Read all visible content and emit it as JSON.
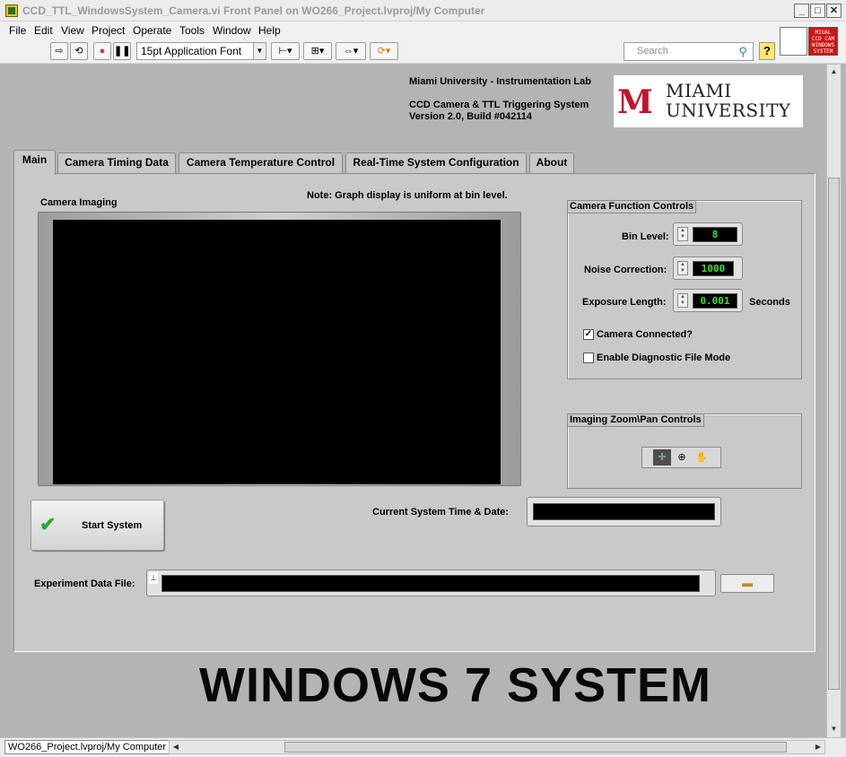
{
  "window": {
    "title": "CCD_TTL_WindowsSystem_Camera.vi Front Panel on WO266_Project.lvproj/My Computer",
    "minimize": "_",
    "maximize": "□",
    "close": "✕"
  },
  "menu": [
    "File",
    "Edit",
    "View",
    "Project",
    "Operate",
    "Tools",
    "Window",
    "Help"
  ],
  "toolbar": {
    "font": "15pt Application Font",
    "search_placeholder": "Search",
    "help": "?"
  },
  "vi_icon_text": [
    "MIUAL",
    "CCD CAM",
    "WINDOWS",
    "SYSTEM"
  ],
  "header": {
    "lab": "Miami University - Instrumentation Lab",
    "system": "CCD Camera & TTL Triggering System",
    "version": "Version 2.0, Build #042114",
    "logo_mark": "M",
    "logo_line1": "MIAMI",
    "logo_line2": "UNIVERSITY"
  },
  "tabs": [
    "Main",
    "Camera Timing Data",
    "Camera Temperature Control",
    "Real-Time System Configuration",
    "About"
  ],
  "active_tab": "Main",
  "main": {
    "graph_label": "Camera Imaging",
    "note": "Note: Graph display is uniform at bin level.",
    "camera_controls_title": "Camera Function Controls",
    "bin_label": "Bin Level:",
    "bin_value": "8",
    "noise_label": "Noise Correction:",
    "noise_value": "1000",
    "exposure_label": "Exposure Length:",
    "exposure_value": "0.001",
    "exposure_unit": "Seconds",
    "camera_connected_label": "Camera Connected?",
    "camera_connected": true,
    "diagnostic_label": "Enable Diagnostic File Mode",
    "diagnostic": false,
    "zoom_title": "Imaging Zoom\\Pan Controls",
    "start_label": "Start System",
    "time_label": "Current System Time & Date:",
    "time_value": "",
    "data_file_label": "Experiment Data File:",
    "data_file_value": ""
  },
  "banner": "WINDOWS 7 SYSTEM",
  "status": {
    "context": "WO266_Project.lvproj/My Computer"
  }
}
